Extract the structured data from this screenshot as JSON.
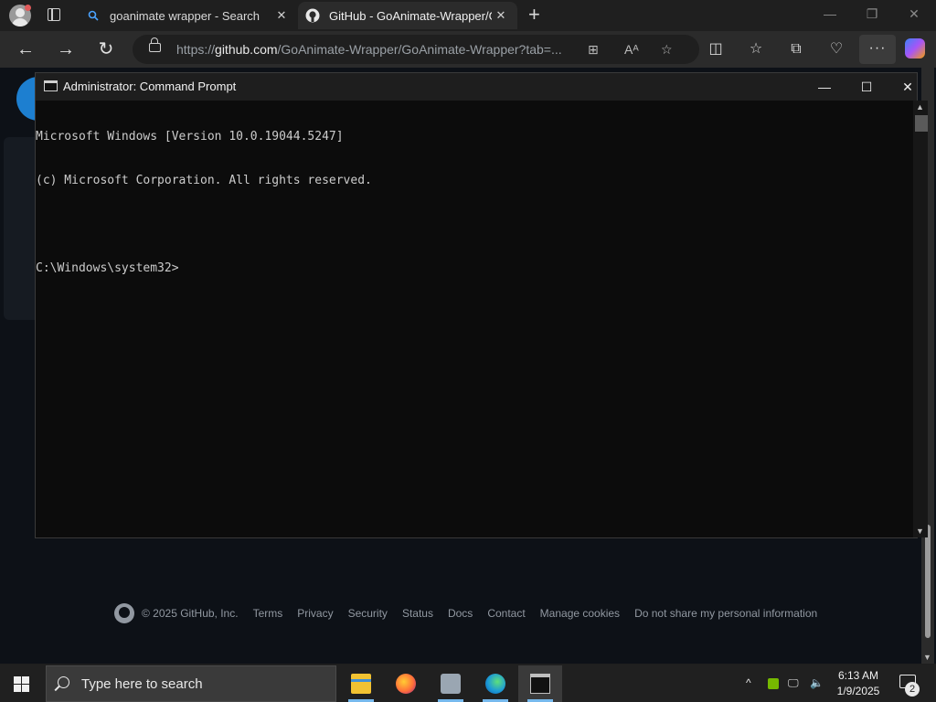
{
  "browser": {
    "tabs": [
      {
        "title": "goanimate wrapper - Search",
        "favicon": "search-icon"
      },
      {
        "title": "GitHub - GoAnimate-Wrapper/Gc",
        "favicon": "github-icon"
      }
    ],
    "close_glyph": "✕",
    "newtab_glyph": "+",
    "window": {
      "minimize": "—",
      "restore": "❐",
      "close": "✕"
    },
    "nav": {
      "back": "←",
      "forward": "→",
      "refresh": "↻"
    },
    "address": {
      "prefix": "https://",
      "domain": "github.com",
      "path": "/GoAnimate-Wrapper/GoAnimate-Wrapper?tab=..."
    },
    "toolbar_glyphs": {
      "split": "◫",
      "favorites": "☆",
      "collections": "⧉",
      "health": "♡",
      "more": "···"
    }
  },
  "page": {
    "footer": {
      "copyright": "© 2025 GitHub, Inc.",
      "links": [
        "Terms",
        "Privacy",
        "Security",
        "Status",
        "Docs",
        "Contact",
        "Manage cookies",
        "Do not share my personal information"
      ]
    }
  },
  "cmd": {
    "title": "Administrator: Command Prompt",
    "controls": {
      "minimize": "—",
      "maximize": "☐",
      "close": "✕"
    },
    "lines": [
      "Microsoft Windows [Version 10.0.19044.5247]",
      "(c) Microsoft Corporation. All rights reserved.",
      "",
      "C:\\Windows\\system32>"
    ]
  },
  "taskbar": {
    "search_placeholder": "Type here to search",
    "apps": [
      "file-explorer",
      "firefox",
      "windows-explorer",
      "edge",
      "command-prompt"
    ],
    "tray": {
      "chevron": "^",
      "time": "6:13 AM",
      "date": "1/9/2025",
      "notifications": "2"
    }
  }
}
